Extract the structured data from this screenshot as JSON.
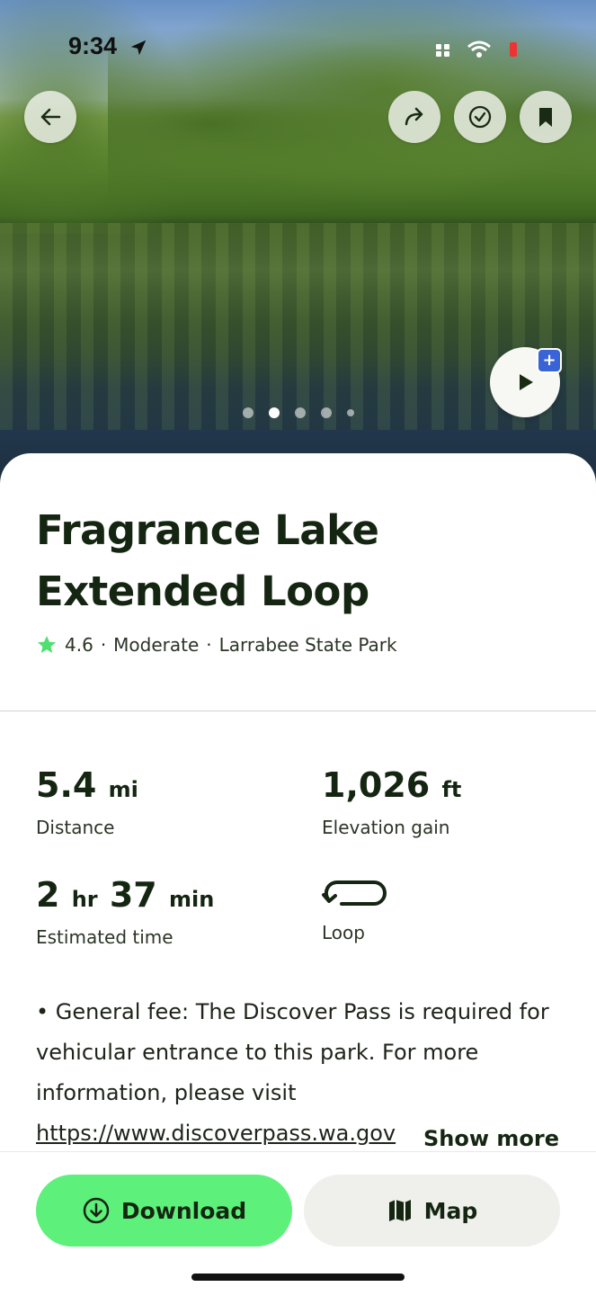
{
  "status_bar": {
    "time": "9:34"
  },
  "hero": {
    "photo_count": 5,
    "active_index": 1
  },
  "trail": {
    "title": "Fragrance Lake Extended Loop",
    "rating": "4.6",
    "difficulty": "Moderate",
    "location": "Larrabee State Park",
    "separator": "·"
  },
  "stats": {
    "distance": {
      "value": "5.4",
      "unit": "mi",
      "label": "Distance"
    },
    "elevation": {
      "value": "1,026",
      "unit": "ft",
      "label": "Elevation gain"
    },
    "time": {
      "hours": "2",
      "hours_unit": "hr",
      "minutes": "37",
      "minutes_unit": "min",
      "label": "Estimated time"
    },
    "route_type": {
      "label": "Loop"
    }
  },
  "description": {
    "text": "• General fee: The Discover Pass is required for vehicular entrance to this park. For more information, please visit ",
    "link": "https://www.discoverpass.wa.gov",
    "show_more": "Show more"
  },
  "actions": {
    "download_label": "Download",
    "map_label": "Map"
  },
  "colors": {
    "accent": "#5df07b",
    "star": "#4fe06f",
    "text_dark": "#142611",
    "badge_blue": "#3a63d6"
  }
}
